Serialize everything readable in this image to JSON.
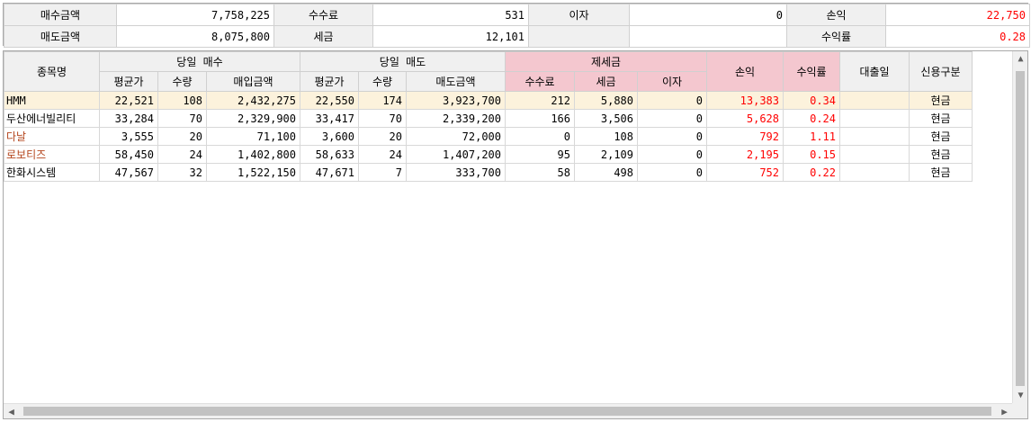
{
  "summary": {
    "buy_amount_label": "매수금액",
    "buy_amount": "7,758,225",
    "fee_label": "수수료",
    "fee": "531",
    "interest_label": "이자",
    "interest": "0",
    "pl_label": "손익",
    "pl": "22,750",
    "sell_amount_label": "매도금액",
    "sell_amount": "8,075,800",
    "tax_label": "세금",
    "tax": "12,101",
    "return_label": "수익률",
    "return_rate": "0.28"
  },
  "grid": {
    "headers": {
      "stock_name": "종목명",
      "today_buy": "당일 매수",
      "today_sell": "당일 매도",
      "taxes_fees": "제세금",
      "profit_loss": "손익",
      "return_rate": "수익률",
      "loan_date": "대출일",
      "credit_type": "신용구분",
      "buy_avg": "평균가",
      "buy_qty": "수량",
      "buy_amount": "매입금액",
      "sell_avg": "평균가",
      "sell_qty": "수량",
      "sell_amount": "매도금액",
      "fee": "수수료",
      "tax": "세금",
      "interest": "이자"
    },
    "rows": [
      {
        "name": "HMM",
        "buy_avg": "22,521",
        "buy_qty": "108",
        "buy_amount": "2,432,275",
        "sell_avg": "22,550",
        "sell_qty": "174",
        "sell_amount": "3,923,700",
        "fee": "212",
        "tax": "5,880",
        "interest": "0",
        "pl": "13,383",
        "rate": "0.34",
        "loan_date": "",
        "credit": "현금"
      },
      {
        "name": "두산에너빌리티",
        "buy_avg": "33,284",
        "buy_qty": "70",
        "buy_amount": "2,329,900",
        "sell_avg": "33,417",
        "sell_qty": "70",
        "sell_amount": "2,339,200",
        "fee": "166",
        "tax": "3,506",
        "interest": "0",
        "pl": "5,628",
        "rate": "0.24",
        "loan_date": "",
        "credit": "현금"
      },
      {
        "name": "다날",
        "buy_avg": "3,555",
        "buy_qty": "20",
        "buy_amount": "71,100",
        "sell_avg": "3,600",
        "sell_qty": "20",
        "sell_amount": "72,000",
        "fee": "0",
        "tax": "108",
        "interest": "0",
        "pl": "792",
        "rate": "1.11",
        "loan_date": "",
        "credit": "현금"
      },
      {
        "name": "로보티즈",
        "buy_avg": "58,450",
        "buy_qty": "24",
        "buy_amount": "1,402,800",
        "sell_avg": "58,633",
        "sell_qty": "24",
        "sell_amount": "1,407,200",
        "fee": "95",
        "tax": "2,109",
        "interest": "0",
        "pl": "2,195",
        "rate": "0.15",
        "loan_date": "",
        "credit": "현금"
      },
      {
        "name": "한화시스템",
        "buy_avg": "47,567",
        "buy_qty": "32",
        "buy_amount": "1,522,150",
        "sell_avg": "47,671",
        "sell_qty": "7",
        "sell_amount": "333,700",
        "fee": "58",
        "tax": "498",
        "interest": "0",
        "pl": "752",
        "rate": "0.22",
        "loan_date": "",
        "credit": "현금"
      }
    ]
  },
  "colors": {
    "profit": "#ff0000",
    "kosdaq_name": "#b4461e",
    "selected_row": "#fcf2dc",
    "tax_header": "#f4c7cf"
  },
  "icons": {
    "scroll_up": "chevron-up-icon",
    "scroll_down": "chevron-down-icon",
    "scroll_left": "chevron-left-icon",
    "scroll_right": "chevron-right-icon"
  }
}
